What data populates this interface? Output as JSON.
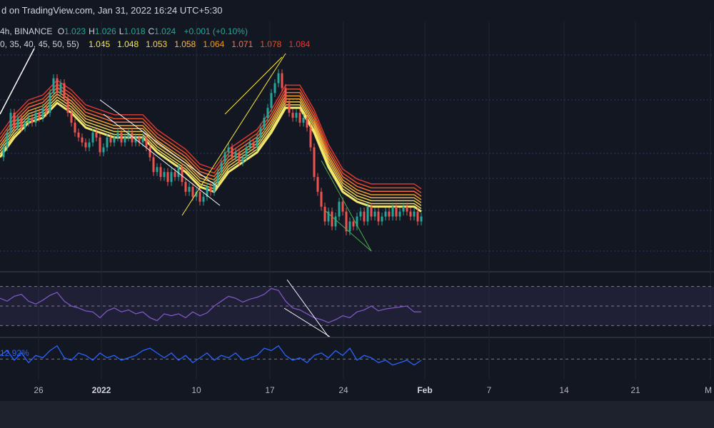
{
  "header": {
    "text": "d on TradingView.com, Jan 31, 2022 16:24 UTC+5:30"
  },
  "legend": {
    "symbol": "4h, BINANCE",
    "ohlc": [
      {
        "label": "O",
        "value": "1.023"
      },
      {
        "label": "H",
        "value": "1.026"
      },
      {
        "label": "L",
        "value": "1.018"
      },
      {
        "label": "C",
        "value": "1.024"
      }
    ],
    "change": "+0.001 (+0.10%)",
    "ribbon_periods": "0, 35, 40, 45, 50, 55)",
    "ribbon_values": [
      {
        "value": "1.045",
        "color": "#ffeb3b"
      },
      {
        "value": "1.048",
        "color": "#ffeb3b"
      },
      {
        "value": "1.053",
        "color": "#ffd54f"
      },
      {
        "value": "1.058",
        "color": "#ffb74d"
      },
      {
        "value": "1.064",
        "color": "#ff9800"
      },
      {
        "value": "1.071",
        "color": "#ff7043"
      },
      {
        "value": "1.078",
        "color": "#f4511e"
      },
      {
        "value": "1.084",
        "color": "#e53935"
      }
    ]
  },
  "indicator2": {
    "label": "12.92%"
  },
  "chart_data": {
    "type": "line",
    "x_ticks": [
      {
        "label": "26",
        "bold": false
      },
      {
        "label": "2022",
        "bold": true
      },
      {
        "label": "10",
        "bold": false
      },
      {
        "label": "17",
        "bold": false
      },
      {
        "label": "24",
        "bold": false
      },
      {
        "label": "Feb",
        "bold": true
      },
      {
        "label": "7",
        "bold": false
      },
      {
        "label": "14",
        "bold": false
      },
      {
        "label": "21",
        "bold": false
      },
      {
        "label": "M",
        "bold": false
      }
    ],
    "price_series": [
      [
        0,
        1.06
      ],
      [
        5,
        1.08
      ],
      [
        10,
        1.11
      ],
      [
        15,
        1.15
      ],
      [
        20,
        1.12
      ],
      [
        25,
        1.14
      ],
      [
        30,
        1.12
      ],
      [
        35,
        1.13
      ],
      [
        40,
        1.14
      ],
      [
        45,
        1.13
      ],
      [
        50,
        1.15
      ],
      [
        55,
        1.14
      ],
      [
        60,
        1.16
      ],
      [
        65,
        1.15
      ],
      [
        70,
        1.19
      ],
      [
        75,
        1.22
      ],
      [
        80,
        1.19
      ],
      [
        85,
        1.21
      ],
      [
        90,
        1.18
      ],
      [
        95,
        1.15
      ],
      [
        100,
        1.13
      ],
      [
        105,
        1.11
      ],
      [
        110,
        1.1
      ],
      [
        115,
        1.09
      ],
      [
        120,
        1.08
      ],
      [
        125,
        1.09
      ],
      [
        130,
        1.11
      ],
      [
        135,
        1.1
      ],
      [
        140,
        1.07
      ],
      [
        145,
        1.08
      ],
      [
        150,
        1.1
      ],
      [
        155,
        1.09
      ],
      [
        160,
        1.1
      ],
      [
        165,
        1.11
      ],
      [
        170,
        1.09
      ],
      [
        175,
        1.1
      ],
      [
        180,
        1.11
      ],
      [
        185,
        1.09
      ],
      [
        190,
        1.1
      ],
      [
        195,
        1.09
      ],
      [
        200,
        1.1
      ],
      [
        205,
        1.08
      ],
      [
        210,
        1.06
      ],
      [
        215,
        1.03
      ],
      [
        220,
        1.04
      ],
      [
        225,
        1.02
      ],
      [
        230,
        1.03
      ],
      [
        235,
        1.01
      ],
      [
        240,
        1.03
      ],
      [
        245,
        1.02
      ],
      [
        250,
        1.04
      ],
      [
        255,
        1.01
      ],
      [
        260,
        0.99
      ],
      [
        265,
        1.0
      ],
      [
        270,
        0.98
      ],
      [
        275,
        0.99
      ],
      [
        280,
        0.97
      ],
      [
        285,
        0.98
      ],
      [
        290,
        1.0
      ],
      [
        295,
        0.99
      ],
      [
        300,
        1.01
      ],
      [
        305,
        1.03
      ],
      [
        310,
        1.05
      ],
      [
        315,
        1.07
      ],
      [
        320,
        1.08
      ],
      [
        325,
        1.06
      ],
      [
        330,
        1.07
      ],
      [
        335,
        1.05
      ],
      [
        340,
        1.06
      ],
      [
        345,
        1.08
      ],
      [
        350,
        1.09
      ],
      [
        355,
        1.08
      ],
      [
        360,
        1.1
      ],
      [
        365,
        1.12
      ],
      [
        370,
        1.14
      ],
      [
        375,
        1.16
      ],
      [
        380,
        1.19
      ],
      [
        385,
        1.21
      ],
      [
        390,
        1.23
      ],
      [
        395,
        1.2
      ],
      [
        400,
        1.17
      ],
      [
        405,
        1.15
      ],
      [
        410,
        1.14
      ],
      [
        415,
        1.15
      ],
      [
        420,
        1.13
      ],
      [
        425,
        1.14
      ],
      [
        430,
        1.12
      ],
      [
        435,
        1.08
      ],
      [
        440,
        1.02
      ],
      [
        445,
        0.99
      ],
      [
        450,
        0.96
      ],
      [
        455,
        0.93
      ],
      [
        460,
        0.95
      ],
      [
        465,
        0.92
      ],
      [
        470,
        0.94
      ],
      [
        475,
        0.97
      ],
      [
        480,
        0.95
      ],
      [
        485,
        0.91
      ],
      [
        490,
        0.93
      ],
      [
        495,
        0.92
      ],
      [
        500,
        0.94
      ],
      [
        505,
        0.95
      ],
      [
        510,
        0.93
      ],
      [
        515,
        0.96
      ],
      [
        520,
        0.94
      ],
      [
        525,
        0.95
      ],
      [
        530,
        0.93
      ],
      [
        535,
        0.94
      ],
      [
        540,
        0.95
      ],
      [
        545,
        0.94
      ],
      [
        550,
        0.96
      ],
      [
        555,
        0.94
      ],
      [
        560,
        0.95
      ],
      [
        565,
        0.96
      ],
      [
        570,
        0.95
      ],
      [
        575,
        0.94
      ],
      [
        580,
        0.95
      ],
      [
        585,
        0.93
      ],
      [
        590,
        0.94
      ]
    ],
    "ema_series": [
      [
        0,
        1.06
      ],
      [
        20,
        1.1
      ],
      [
        40,
        1.13
      ],
      [
        60,
        1.14
      ],
      [
        80,
        1.17
      ],
      [
        100,
        1.15
      ],
      [
        120,
        1.12
      ],
      [
        140,
        1.11
      ],
      [
        160,
        1.1
      ],
      [
        180,
        1.1
      ],
      [
        200,
        1.1
      ],
      [
        220,
        1.07
      ],
      [
        240,
        1.05
      ],
      [
        260,
        1.03
      ],
      [
        280,
        1.0
      ],
      [
        300,
        0.99
      ],
      [
        320,
        1.03
      ],
      [
        340,
        1.05
      ],
      [
        360,
        1.07
      ],
      [
        380,
        1.11
      ],
      [
        400,
        1.16
      ],
      [
        420,
        1.16
      ],
      [
        440,
        1.11
      ],
      [
        460,
        1.04
      ],
      [
        480,
        0.99
      ],
      [
        500,
        0.97
      ],
      [
        520,
        0.96
      ],
      [
        540,
        0.96
      ],
      [
        560,
        0.96
      ],
      [
        580,
        0.96
      ],
      [
        590,
        0.95
      ]
    ],
    "ribbon_offsets": [
      0.0,
      0.006,
      0.012,
      0.018,
      0.024,
      0.031,
      0.038,
      0.046
    ],
    "ribbon_colors": [
      "#fff176",
      "#ffee58",
      "#ffd54f",
      "#ffb74d",
      "#ffa726",
      "#ff7043",
      "#f4511e",
      "#e53935"
    ],
    "price_ylim": [
      0.87,
      1.27
    ],
    "rsi_series": [
      [
        0,
        58
      ],
      [
        10,
        55
      ],
      [
        20,
        60
      ],
      [
        30,
        62
      ],
      [
        40,
        55
      ],
      [
        50,
        52
      ],
      [
        60,
        56
      ],
      [
        70,
        61
      ],
      [
        80,
        64
      ],
      [
        90,
        55
      ],
      [
        100,
        50
      ],
      [
        110,
        48
      ],
      [
        120,
        45
      ],
      [
        130,
        44
      ],
      [
        140,
        38
      ],
      [
        150,
        45
      ],
      [
        160,
        48
      ],
      [
        170,
        44
      ],
      [
        180,
        46
      ],
      [
        190,
        42
      ],
      [
        200,
        44
      ],
      [
        210,
        38
      ],
      [
        220,
        35
      ],
      [
        230,
        42
      ],
      [
        240,
        40
      ],
      [
        250,
        42
      ],
      [
        260,
        38
      ],
      [
        270,
        44
      ],
      [
        280,
        40
      ],
      [
        290,
        43
      ],
      [
        300,
        50
      ],
      [
        310,
        55
      ],
      [
        320,
        60
      ],
      [
        330,
        58
      ],
      [
        340,
        54
      ],
      [
        350,
        57
      ],
      [
        360,
        59
      ],
      [
        370,
        62
      ],
      [
        380,
        68
      ],
      [
        390,
        66
      ],
      [
        400,
        55
      ],
      [
        410,
        48
      ],
      [
        420,
        46
      ],
      [
        430,
        42
      ],
      [
        440,
        38
      ],
      [
        450,
        36
      ],
      [
        460,
        33
      ],
      [
        470,
        36
      ],
      [
        480,
        40
      ],
      [
        490,
        38
      ],
      [
        500,
        44
      ],
      [
        510,
        46
      ],
      [
        520,
        50
      ],
      [
        530,
        45
      ],
      [
        540,
        47
      ],
      [
        550,
        48
      ],
      [
        560,
        49
      ],
      [
        570,
        50
      ],
      [
        580,
        44
      ],
      [
        590,
        44
      ]
    ],
    "rsi_ylim": [
      20,
      80
    ],
    "rsi_bands": [
      70,
      50,
      30
    ],
    "pct_series": [
      [
        0,
        10
      ],
      [
        10,
        12
      ],
      [
        20,
        8
      ],
      [
        30,
        11
      ],
      [
        40,
        7
      ],
      [
        50,
        10
      ],
      [
        60,
        9
      ],
      [
        70,
        12
      ],
      [
        80,
        14
      ],
      [
        90,
        9
      ],
      [
        100,
        8
      ],
      [
        110,
        11
      ],
      [
        120,
        10
      ],
      [
        130,
        8
      ],
      [
        140,
        11
      ],
      [
        150,
        9
      ],
      [
        160,
        10
      ],
      [
        170,
        8
      ],
      [
        180,
        9
      ],
      [
        190,
        10
      ],
      [
        200,
        12
      ],
      [
        210,
        13
      ],
      [
        220,
        11
      ],
      [
        230,
        9
      ],
      [
        240,
        11
      ],
      [
        250,
        8
      ],
      [
        260,
        10
      ],
      [
        270,
        7
      ],
      [
        280,
        9
      ],
      [
        290,
        11
      ],
      [
        300,
        8
      ],
      [
        310,
        10
      ],
      [
        320,
        9
      ],
      [
        330,
        11
      ],
      [
        340,
        8
      ],
      [
        350,
        9
      ],
      [
        360,
        10
      ],
      [
        370,
        13
      ],
      [
        380,
        12
      ],
      [
        390,
        14
      ],
      [
        400,
        10
      ],
      [
        410,
        8
      ],
      [
        420,
        9
      ],
      [
        430,
        7
      ],
      [
        440,
        10
      ],
      [
        450,
        11
      ],
      [
        460,
        9
      ],
      [
        470,
        12
      ],
      [
        480,
        10
      ],
      [
        490,
        13
      ],
      [
        500,
        8
      ],
      [
        510,
        10
      ],
      [
        520,
        9
      ],
      [
        530,
        7
      ],
      [
        540,
        8
      ],
      [
        550,
        6
      ],
      [
        560,
        7
      ],
      [
        570,
        8
      ],
      [
        580,
        6
      ],
      [
        590,
        8
      ]
    ],
    "pct_ylim": [
      0,
      16
    ],
    "pct_reference": 8.5
  }
}
